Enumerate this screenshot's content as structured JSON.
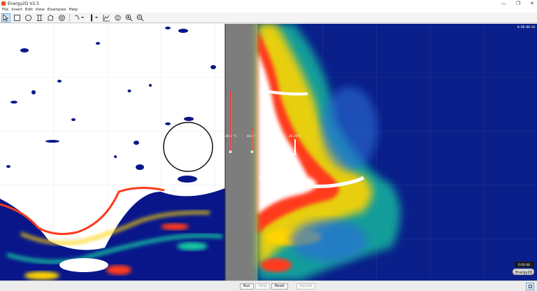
{
  "window": {
    "title": "Energy2D V2.5",
    "controls": [
      "—",
      "❐",
      "✕"
    ]
  },
  "menu": [
    "File",
    "Insert",
    "Edit",
    "View",
    "Examples",
    "Help"
  ],
  "toolbar": {
    "tools": [
      "select-arrow",
      "rectangle",
      "ellipse",
      "polygon-beam",
      "blob",
      "annulus",
      "thermometer",
      "heat-flux-sensor",
      "graph",
      "zoom-in",
      "zoom-out"
    ]
  },
  "sim": {
    "clock": "0:00:00:46",
    "thermometer_left": "29.1 °C",
    "thermometer_right": "44.3 °C",
    "probe_reading": "26.25°C",
    "time_readout": "0:00:48",
    "logo": "Energy2D",
    "colors": {
      "background": "#0a1f8a",
      "hot": "#ffffff",
      "warm": "#ff3a1a",
      "mid": "#ffd400",
      "cool": "#18c8a0",
      "cold": "#08168a"
    }
  },
  "controls": {
    "run": "Run",
    "stop": "Stop",
    "reset": "Reset",
    "reload": "Reload"
  }
}
